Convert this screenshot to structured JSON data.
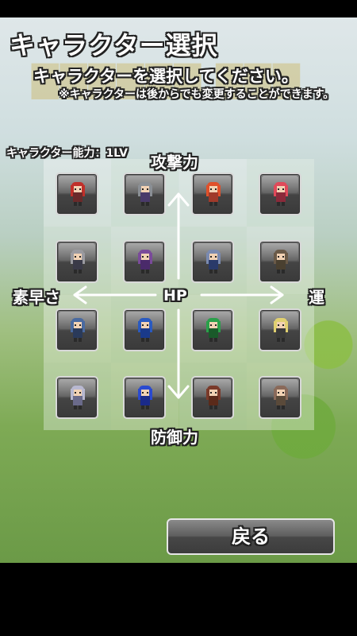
{
  "header": {
    "title": "キャラクター選択",
    "subtitle": "キャラクターを選択してください。",
    "note": "※キャラクターは後からでも変更することができます。"
  },
  "ability_label": "キャラクター能力：1LV",
  "axes": {
    "top": "攻撃力",
    "bottom": "防御力",
    "left": "素早さ",
    "right": "運",
    "center": "HP"
  },
  "characters": [
    {
      "name": "character-1",
      "hair": "#c0302a",
      "body": "#6a2a2a"
    },
    {
      "name": "character-2",
      "hair": "#8a8f95",
      "body": "#4a3a6a"
    },
    {
      "name": "character-3",
      "hair": "#e0502a",
      "body": "#a03a2a"
    },
    {
      "name": "character-4",
      "hair": "#e04a5a",
      "body": "#8a2a3a"
    },
    {
      "name": "character-5",
      "hair": "#9a9aa0",
      "body": "#3a3a48"
    },
    {
      "name": "character-6",
      "hair": "#7a4a9a",
      "body": "#4a2a6a"
    },
    {
      "name": "character-7",
      "hair": "#7a8ab0",
      "body": "#2a3a6a"
    },
    {
      "name": "character-8",
      "hair": "#6a5a48",
      "body": "#4a4030"
    },
    {
      "name": "character-9",
      "hair": "#4a6aa0",
      "body": "#2a3a5a"
    },
    {
      "name": "character-10",
      "hair": "#2a5ac0",
      "body": "#1a3a8a"
    },
    {
      "name": "character-11",
      "hair": "#2aa04a",
      "body": "#1a5a2a"
    },
    {
      "name": "character-12",
      "hair": "#e0d070",
      "body": "#3a3a3a"
    },
    {
      "name": "character-13",
      "hair": "#b8b8d0",
      "body": "#6a6a8a"
    },
    {
      "name": "character-14",
      "hair": "#2a4ad0",
      "body": "#1a2a8a"
    },
    {
      "name": "character-15",
      "hair": "#7a3a2a",
      "body": "#5a2a1a"
    },
    {
      "name": "character-16",
      "hair": "#8a6a5a",
      "body": "#5a4a3a"
    }
  ],
  "back_button": "戻る"
}
